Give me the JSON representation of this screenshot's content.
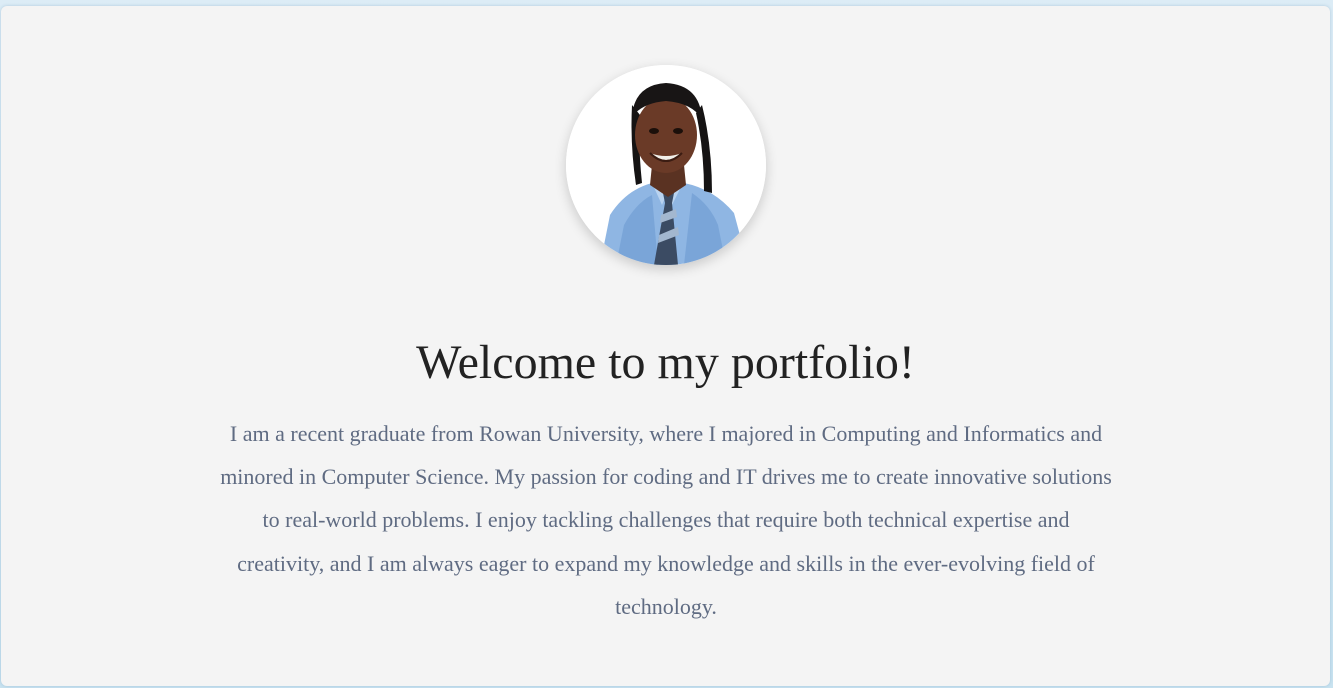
{
  "profile": {
    "photo_icon": "portrait-photo",
    "heading": "Welcome to my portfolio!",
    "bio": "I am a recent graduate from Rowan University, where I majored in Computing and Informatics and minored in Computer Science. My passion for coding and IT drives me to create innovative solutions to real-world problems. I enjoy tackling challenges that require both technical expertise and creativity, and I am always eager to expand my knowledge and skills in the ever-evolving field of technology."
  },
  "colors": {
    "page_background": "#dcecf6",
    "card_background": "#f4f4f4",
    "heading": "#222222",
    "body_text": "#5f6b82"
  }
}
